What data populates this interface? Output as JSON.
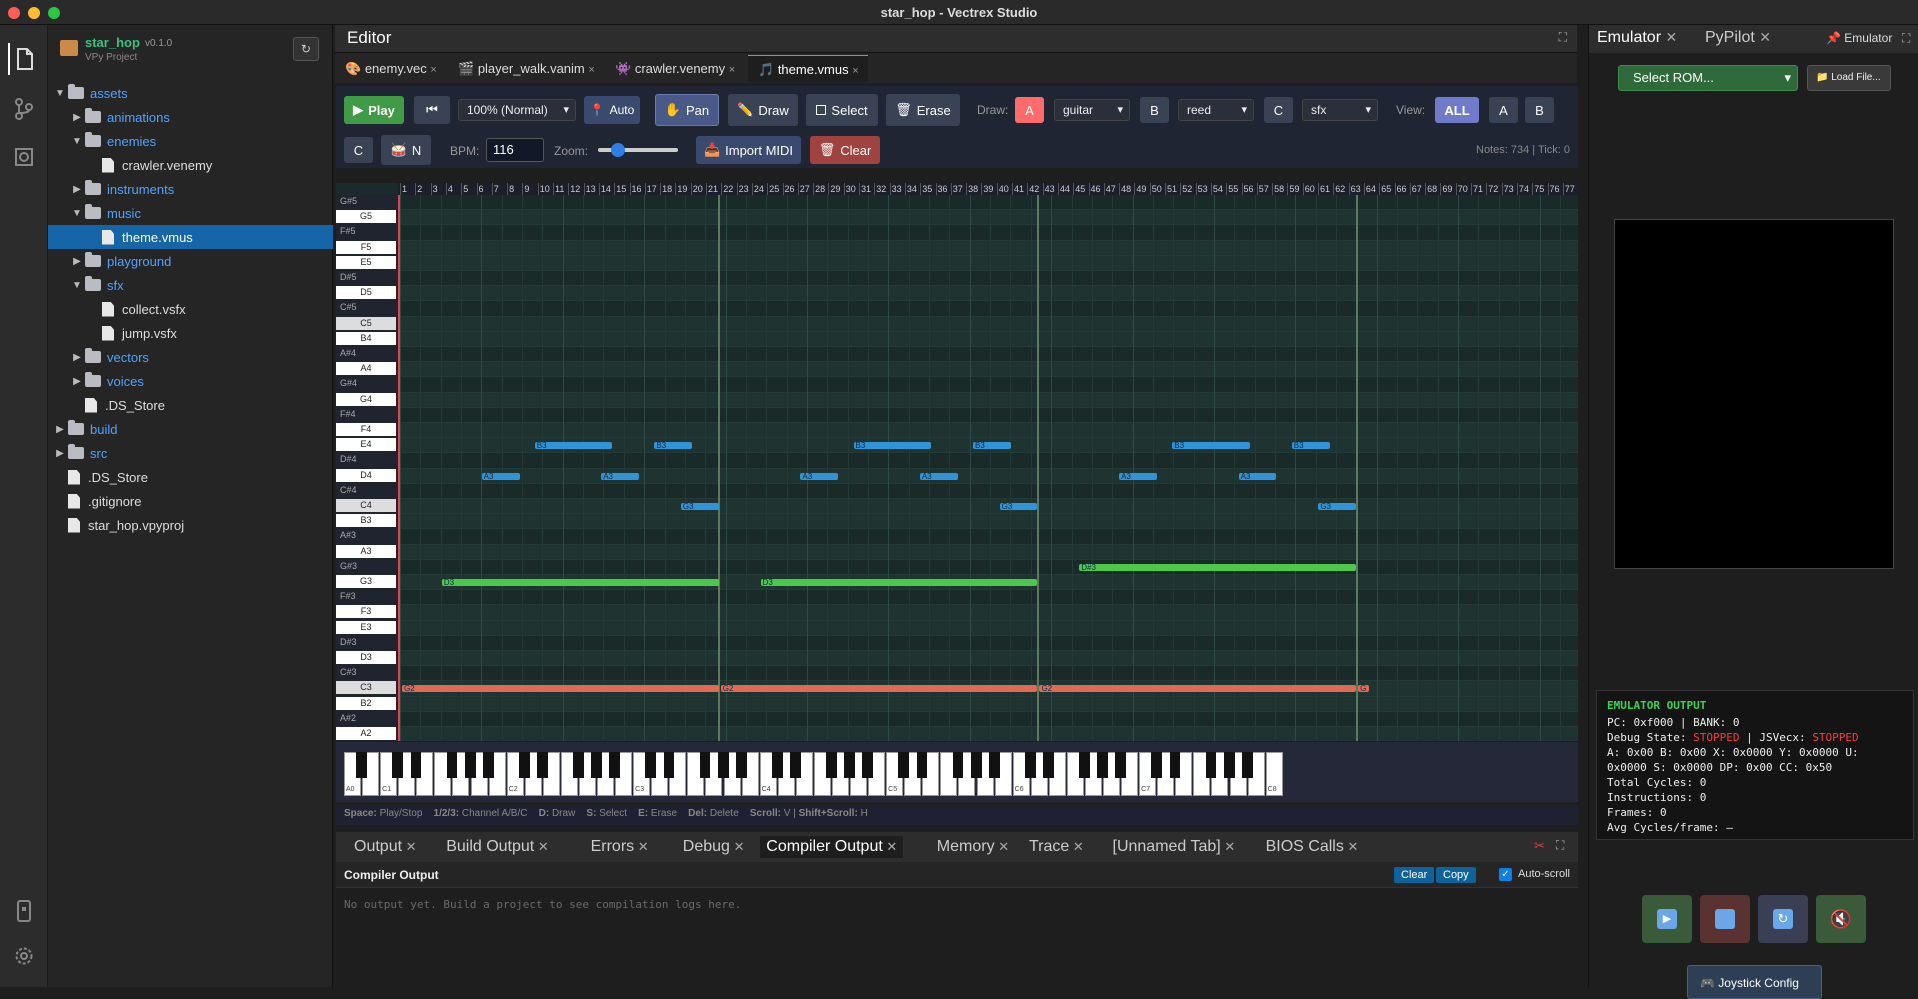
{
  "window": {
    "title": "star_hop - Vectrex Studio"
  },
  "project": {
    "name": "star_hop",
    "version": "v0.1.0",
    "subtitle": "VPy Project"
  },
  "tree": [
    {
      "label": "assets",
      "type": "folder",
      "open": true,
      "depth": 0
    },
    {
      "label": "animations",
      "type": "folder",
      "open": false,
      "depth": 1
    },
    {
      "label": "enemies",
      "type": "folder",
      "open": true,
      "depth": 1
    },
    {
      "label": "crawler.venemy",
      "type": "file",
      "depth": 2
    },
    {
      "label": "instruments",
      "type": "folder",
      "open": false,
      "depth": 1
    },
    {
      "label": "music",
      "type": "folder",
      "open": true,
      "depth": 1
    },
    {
      "label": "theme.vmus",
      "type": "file",
      "depth": 2,
      "selected": true
    },
    {
      "label": "playground",
      "type": "folder",
      "open": false,
      "depth": 1
    },
    {
      "label": "sfx",
      "type": "folder",
      "open": true,
      "depth": 1
    },
    {
      "label": "collect.vsfx",
      "type": "file",
      "depth": 2
    },
    {
      "label": "jump.vsfx",
      "type": "file",
      "depth": 2
    },
    {
      "label": "vectors",
      "type": "folder",
      "open": false,
      "depth": 1
    },
    {
      "label": "voices",
      "type": "folder",
      "open": false,
      "depth": 1
    },
    {
      "label": ".DS_Store",
      "type": "file",
      "depth": 1
    },
    {
      "label": "build",
      "type": "folder",
      "open": false,
      "depth": 0
    },
    {
      "label": "src",
      "type": "folder",
      "open": false,
      "depth": 0
    },
    {
      "label": ".DS_Store",
      "type": "file",
      "depth": 0
    },
    {
      "label": ".gitignore",
      "type": "file",
      "depth": 0
    },
    {
      "label": "star_hop.vpyproj",
      "type": "file",
      "depth": 0
    }
  ],
  "editor": {
    "title": "Editor",
    "tabs": [
      {
        "label": "enemy.vec"
      },
      {
        "label": "player_walk.vanim"
      },
      {
        "label": "crawler.venemy"
      },
      {
        "label": "theme.vmus",
        "active": true
      }
    ],
    "toolbar": {
      "play": "Play",
      "speed": "100% (Normal)",
      "auto": "Auto",
      "pan": "Pan",
      "draw": "Draw",
      "select": "Select",
      "erase": "Erase",
      "draw_label": "Draw:",
      "ch_a": "A",
      "ch_a_inst": "guitar",
      "ch_b": "B",
      "ch_b_inst": "reed",
      "ch_c": "C",
      "ch_c_inst": "sfx",
      "view_label": "View:",
      "view_all": "ALL",
      "view_a": "A",
      "view_b": "B",
      "view_c": "C",
      "noise": "N",
      "bpm_label": "BPM:",
      "bpm_value": "116",
      "zoom_label": "Zoom:",
      "import_midi": "Import MIDI",
      "clear": "Clear",
      "status": "Notes: 734 | Tick: 0"
    },
    "piano_labels": [
      "G#5",
      "G5",
      "F#5",
      "F5",
      "E5",
      "D#5",
      "D5",
      "C#5",
      "C5",
      "B4",
      "A#4",
      "A4",
      "G#4",
      "G4",
      "F#4",
      "F4",
      "E4",
      "D#4",
      "D4",
      "C#4",
      "C4",
      "B3",
      "A#3",
      "A3",
      "G#3",
      "G3",
      "F#3",
      "F3",
      "E3",
      "D#3",
      "D3",
      "C#3",
      "C3",
      "B2",
      "A#2",
      "A2"
    ],
    "kb_labels": [
      "A0",
      "C1",
      "C2",
      "C3",
      "C4",
      "C5",
      "C6",
      "C7",
      "C8"
    ],
    "help": {
      "k1": "Space:",
      "v1": "Play/Stop",
      "k2": "1/2/3:",
      "v2": "Channel A/B/C",
      "k3": "D:",
      "v3": "Draw",
      "k4": "S:",
      "v4": "Select",
      "k5": "E:",
      "v5": "Erase",
      "k6": "Del:",
      "v6": "Delete",
      "k7": "Scroll:",
      "v7": "V |",
      "k8": "Shift+Scroll:",
      "v8": "H"
    }
  },
  "notes": [
    {
      "label": "B3",
      "start": 10,
      "len": 6,
      "row": 16,
      "color": "#2f95d8"
    },
    {
      "label": "B3",
      "start": 19,
      "len": 3,
      "row": 16,
      "color": "#2f95d8"
    },
    {
      "label": "A3",
      "start": 6,
      "len": 3,
      "row": 18,
      "color": "#2f95d8"
    },
    {
      "label": "A3",
      "start": 15,
      "len": 3,
      "row": 18,
      "color": "#2f95d8"
    },
    {
      "label": "G3",
      "start": 21,
      "len": 3,
      "row": 20,
      "color": "#2f95d8"
    },
    {
      "label": "B3",
      "start": 34,
      "len": 6,
      "row": 16,
      "color": "#2f95d8"
    },
    {
      "label": "B3",
      "start": 43,
      "len": 3,
      "row": 16,
      "color": "#2f95d8"
    },
    {
      "label": "A3",
      "start": 30,
      "len": 3,
      "row": 18,
      "color": "#2f95d8"
    },
    {
      "label": "A3",
      "start": 39,
      "len": 3,
      "row": 18,
      "color": "#2f95d8"
    },
    {
      "label": "G3",
      "start": 45,
      "len": 3,
      "row": 20,
      "color": "#2f95d8"
    },
    {
      "label": "B3",
      "start": 58,
      "len": 6,
      "row": 16,
      "color": "#2f95d8"
    },
    {
      "label": "B3",
      "start": 67,
      "len": 3,
      "row": 16,
      "color": "#2f95d8"
    },
    {
      "label": "A3",
      "start": 54,
      "len": 3,
      "row": 18,
      "color": "#2f95d8"
    },
    {
      "label": "A3",
      "start": 63,
      "len": 3,
      "row": 18,
      "color": "#2f95d8"
    },
    {
      "label": "G3",
      "start": 69,
      "len": 3,
      "row": 20,
      "color": "#2f95d8"
    },
    {
      "label": "D3",
      "start": 3,
      "len": 21,
      "row": 25,
      "color": "#4cc94c"
    },
    {
      "label": "D3",
      "start": 27,
      "len": 21,
      "row": 25,
      "color": "#4cc94c"
    },
    {
      "label": "D#3",
      "start": 51,
      "len": 21,
      "row": 24,
      "color": "#4cc94c"
    },
    {
      "label": "G2",
      "start": 0,
      "len": 24,
      "row": 32,
      "color": "#e06b55"
    },
    {
      "label": "G2",
      "start": 24,
      "len": 24,
      "row": 32,
      "color": "#e06b55"
    },
    {
      "label": "G2",
      "start": 48,
      "len": 24,
      "row": 32,
      "color": "#e06b55"
    },
    {
      "label": "G",
      "start": 72,
      "len": 1,
      "row": 32,
      "color": "#e06b55"
    }
  ],
  "bottom": {
    "tabs": [
      {
        "label": "Output"
      },
      {
        "label": "Build Output"
      },
      {
        "label": "Errors"
      },
      {
        "label": "Debug"
      },
      {
        "label": "Compiler Output",
        "active": true
      },
      {
        "label": "Memory"
      },
      {
        "label": "Trace"
      },
      {
        "label": "[Unnamed Tab]"
      },
      {
        "label": "BIOS Calls"
      }
    ],
    "title": "Compiler Output",
    "clear": "Clear",
    "copy": "Copy",
    "autoscroll": "Auto-scroll",
    "empty": "No output yet. Build a project to see compilation logs here."
  },
  "right": {
    "tabs": [
      {
        "label": "Emulator",
        "active": true
      },
      {
        "label": "PyPilot"
      }
    ],
    "pin": "Emulator",
    "rom_select": "Select ROM...",
    "load": "Load File...",
    "output": {
      "title": "EMULATOR OUTPUT",
      "pc": "PC: 0xf000 | BANK: 0",
      "debug_pre": "Debug State: ",
      "debug_state": "STOPPED",
      "js_pre": " | JSVecx: ",
      "js_state": "STOPPED",
      "regs": "A: 0x00 B: 0x00 X: 0x0000 Y: 0x0000 U: 0x0000 S: 0x0000 DP: 0x00 CC: 0x50",
      "cycles": "Total Cycles: 0",
      "instr": "Instructions: 0",
      "frames": "Frames: 0",
      "avg": "Avg Cycles/frame: —"
    },
    "joystick": "Joystick Config"
  },
  "colors": {
    "accent": "#1565a8",
    "play": "#3f9b45",
    "stopped": "#ff3b3b",
    "emu_title": "#39d353",
    "ch_a": "#ff6b6b",
    "clear": "#a0433e"
  }
}
